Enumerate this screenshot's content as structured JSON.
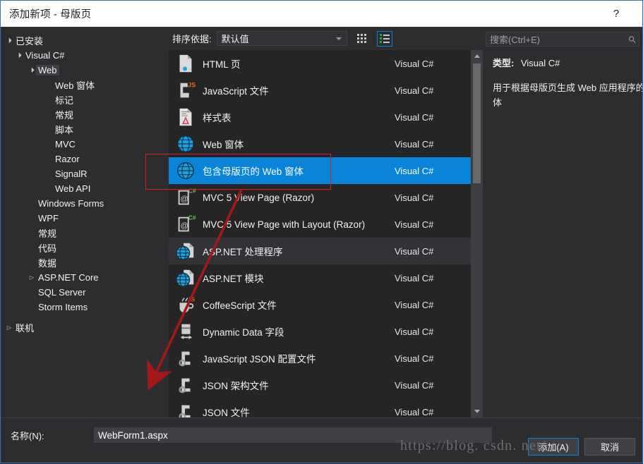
{
  "window": {
    "title": "添加新项 - 母版页",
    "help_label": "?"
  },
  "sidebar": {
    "items": [
      {
        "label": "已安装",
        "level": 0,
        "arrow": "▲",
        "selected": false
      },
      {
        "label": "Visual C#",
        "level": 1,
        "arrow": "▲",
        "selected": false
      },
      {
        "label": "Web",
        "level": 2,
        "arrow": "▲",
        "selected": true
      },
      {
        "label": "Web 窗体",
        "level": 3,
        "arrow": "",
        "selected": false
      },
      {
        "label": "标记",
        "level": 3,
        "arrow": "",
        "selected": false
      },
      {
        "label": "常规",
        "level": 3,
        "arrow": "",
        "selected": false
      },
      {
        "label": "脚本",
        "level": 3,
        "arrow": "",
        "selected": false
      },
      {
        "label": "MVC",
        "level": 3,
        "arrow": "",
        "selected": false
      },
      {
        "label": "Razor",
        "level": 3,
        "arrow": "",
        "selected": false
      },
      {
        "label": "SignalR",
        "level": 3,
        "arrow": "",
        "selected": false
      },
      {
        "label": "Web API",
        "level": 3,
        "arrow": "",
        "selected": false
      },
      {
        "label": "Windows Forms",
        "level": 2,
        "arrow": "",
        "selected": false
      },
      {
        "label": "WPF",
        "level": 2,
        "arrow": "",
        "selected": false
      },
      {
        "label": "常规",
        "level": 2,
        "arrow": "",
        "selected": false
      },
      {
        "label": "代码",
        "level": 2,
        "arrow": "",
        "selected": false
      },
      {
        "label": "数据",
        "level": 2,
        "arrow": "",
        "selected": false
      },
      {
        "label": "ASP.NET Core",
        "level": 2,
        "arrow": "▶",
        "selected": false
      },
      {
        "label": "SQL Server",
        "level": 2,
        "arrow": "",
        "selected": false
      },
      {
        "label": "Storm Items",
        "level": 2,
        "arrow": "",
        "selected": false
      },
      {
        "label": "联机",
        "level": 0,
        "arrow": "▶",
        "selected": false,
        "gap": true
      }
    ]
  },
  "toolbar": {
    "sort_label": "排序依据:",
    "sort_value": "默认值",
    "tile_view_name": "tile-view",
    "list_view_name": "list-view"
  },
  "list": {
    "items": [
      {
        "name": "HTML 页",
        "lang": "Visual C#",
        "icon": "html-file-icon",
        "state": "normal"
      },
      {
        "name": "JavaScript 文件",
        "lang": "Visual C#",
        "icon": "javascript-file-icon",
        "state": "normal"
      },
      {
        "name": "样式表",
        "lang": "Visual C#",
        "icon": "stylesheet-file-icon",
        "state": "normal"
      },
      {
        "name": "Web 窗体",
        "lang": "Visual C#",
        "icon": "web-form-icon",
        "state": "normal"
      },
      {
        "name": "包含母版页的 Web 窗体",
        "lang": "Visual C#",
        "icon": "web-form-masterpage-icon",
        "state": "selected"
      },
      {
        "name": "MVC 5 View Page (Razor)",
        "lang": "Visual C#",
        "icon": "razor-view-icon",
        "state": "normal"
      },
      {
        "name": "MVC 5 View Page with Layout (Razor)",
        "lang": "Visual C#",
        "icon": "razor-view-icon",
        "state": "normal"
      },
      {
        "name": "ASP.NET 处理程序",
        "lang": "Visual C#",
        "icon": "aspnet-handler-icon",
        "state": "alt"
      },
      {
        "name": "ASP.NET 模块",
        "lang": "Visual C#",
        "icon": "aspnet-module-icon",
        "state": "normal"
      },
      {
        "name": "CoffeeScript 文件",
        "lang": "Visual C#",
        "icon": "coffeescript-file-icon",
        "state": "normal"
      },
      {
        "name": "Dynamic Data 字段",
        "lang": "Visual C#",
        "icon": "dynamic-data-field-icon",
        "state": "normal"
      },
      {
        "name": "JavaScript JSON 配置文件",
        "lang": "Visual C#",
        "icon": "json-config-file-icon",
        "state": "normal"
      },
      {
        "name": "JSON 架构文件",
        "lang": "Visual C#",
        "icon": "json-schema-file-icon",
        "state": "normal"
      },
      {
        "name": "JSON 文件",
        "lang": "Visual C#",
        "icon": "json-file-icon",
        "state": "normal"
      }
    ]
  },
  "search": {
    "placeholder": "搜索(Ctrl+E)",
    "value": ""
  },
  "details": {
    "type_label": "类型:",
    "type_value": "Visual C#",
    "description": "用于根据母版页生成 Web 应用程序的窗体"
  },
  "footer": {
    "name_label": "名称(N):",
    "name_value": "WebForm1.aspx",
    "add_button": "添加(A)",
    "cancel_button": "取消"
  },
  "annotations": {
    "watermark": "https://blog. csdn. net/"
  },
  "colors": {
    "accent": "#0a84d8",
    "annotation_red": "#e11d1d",
    "dialog_bg": "#2d2d30",
    "list_bg": "#252526"
  }
}
